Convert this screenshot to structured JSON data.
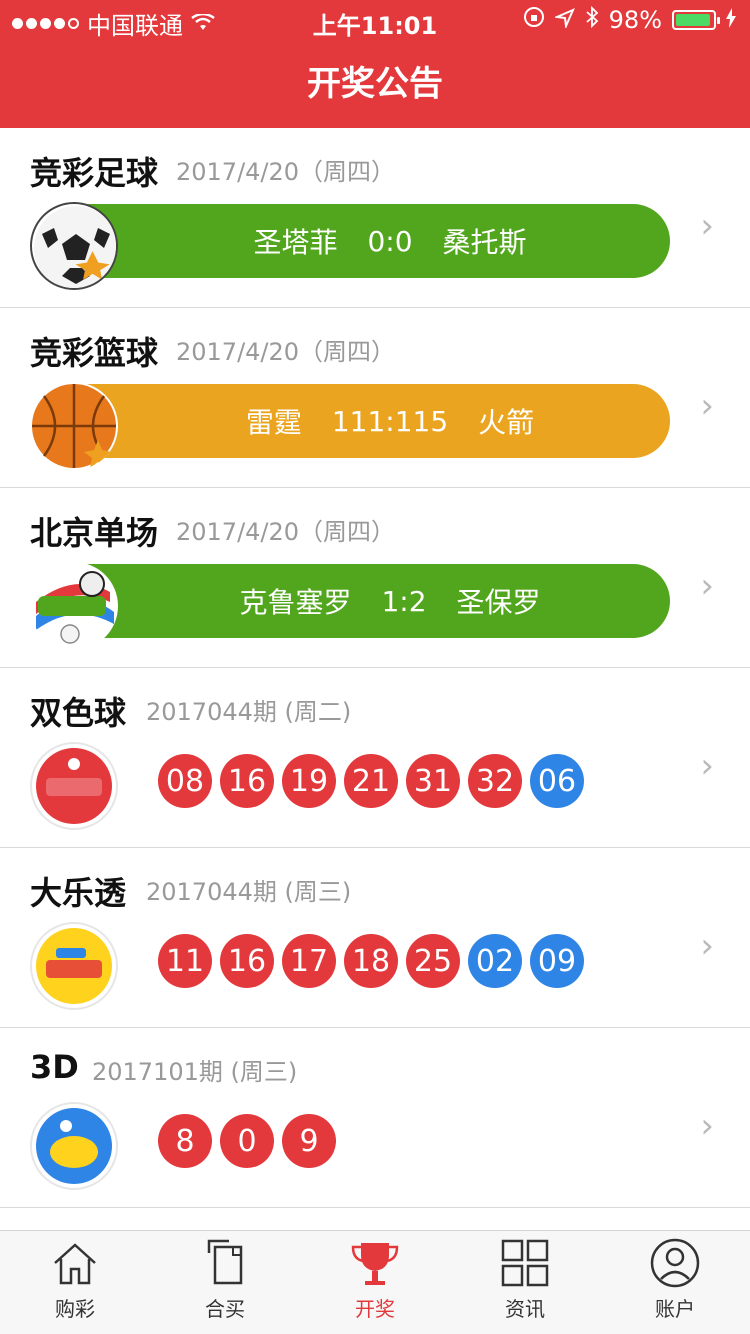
{
  "status_bar": {
    "carrier": "中国联通",
    "time": "上午11:01",
    "battery": "98%"
  },
  "nav": {
    "title": "开奖公告"
  },
  "list": [
    {
      "title": "竞彩足球",
      "date": "2017/4/20（周四）",
      "type": "match",
      "color": "green",
      "home": "圣塔菲",
      "score": "0:0",
      "away": "桑托斯",
      "logo": "soccer-ball-icon"
    },
    {
      "title": "竞彩篮球",
      "date": "2017/4/20（周四）",
      "type": "match",
      "color": "orange",
      "home": "雷霆",
      "score": "111:115",
      "away": "火箭",
      "logo": "basketball-icon"
    },
    {
      "title": "北京单场",
      "date": "2017/4/20（周四）",
      "type": "match",
      "color": "green",
      "home": "克鲁塞罗",
      "score": "1:2",
      "away": "圣保罗",
      "logo": "beijing-single-logo"
    },
    {
      "title": "双色球",
      "date": "2017044期 (周二)",
      "type": "balls",
      "red": [
        "08",
        "16",
        "19",
        "21",
        "31",
        "32"
      ],
      "blue": [
        "06"
      ],
      "logo": "shuangseqiu-logo"
    },
    {
      "title": "大乐透",
      "date": "2017044期 (周三)",
      "type": "balls",
      "red": [
        "11",
        "16",
        "17",
        "18",
        "25"
      ],
      "blue": [
        "02",
        "09"
      ],
      "logo": "daletou-logo"
    },
    {
      "title": "3D",
      "date": "2017101期 (周三)",
      "type": "balls",
      "red": [
        "8",
        "0",
        "9"
      ],
      "blue": [],
      "logo": "3d-logo"
    }
  ],
  "tabs": [
    {
      "label": "购彩",
      "icon": "home-icon"
    },
    {
      "label": "合买",
      "icon": "documents-icon"
    },
    {
      "label": "开奖",
      "icon": "trophy-icon",
      "active": true
    },
    {
      "label": "资讯",
      "icon": "grid-icon"
    },
    {
      "label": "账户",
      "icon": "user-icon"
    }
  ],
  "colors": {
    "red": "#e3393c",
    "blue": "#2f85e6",
    "green": "#52a61e",
    "orange": "#eaa420",
    "gray": "#999999",
    "dark": "#111111"
  }
}
